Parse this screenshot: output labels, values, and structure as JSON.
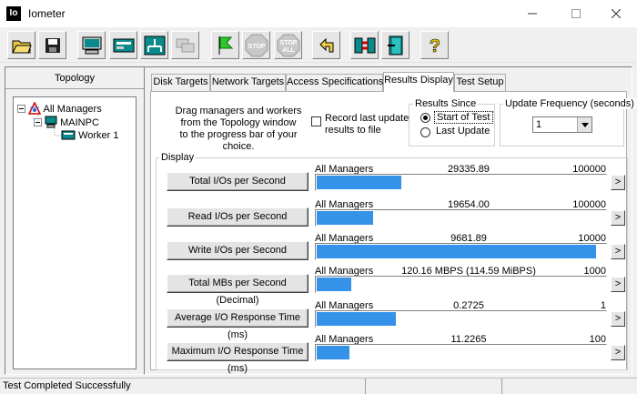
{
  "window": {
    "title": "Iometer",
    "icon_text": "Io"
  },
  "toolbar": {
    "buttons": [
      {
        "icon": "open-folder-icon"
      },
      {
        "icon": "save-disk-icon"
      },
      {
        "icon": "new-manager-icon"
      },
      {
        "icon": "new-disk-worker-icon"
      },
      {
        "icon": "new-network-worker-icon"
      },
      {
        "icon": "duplicate-worker-icon"
      },
      {
        "icon": "start-flag-icon"
      },
      {
        "icon": "stop-icon",
        "label": "STOP"
      },
      {
        "icon": "stop-all-icon",
        "label_top": "STOP",
        "label_bottom": "ALL"
      },
      {
        "icon": "reset-workers-icon"
      },
      {
        "icon": "disconnect-icon"
      },
      {
        "icon": "exit-door-icon"
      },
      {
        "icon": "help-icon",
        "label": "?"
      }
    ]
  },
  "topology": {
    "header": "Topology",
    "tree": [
      {
        "label": "All Managers",
        "icon": "managers-icon"
      },
      {
        "label": "MAINPC",
        "icon": "computer-icon"
      },
      {
        "label": "Worker 1",
        "icon": "disk-worker-icon"
      }
    ]
  },
  "tabs": [
    {
      "label": "Disk Targets",
      "active": false
    },
    {
      "label": "Network Targets",
      "active": false
    },
    {
      "label": "Access Specifications",
      "active": false
    },
    {
      "label": "Results Display",
      "active": true
    },
    {
      "label": "Test Setup",
      "active": false
    }
  ],
  "results": {
    "instructions": [
      "Drag managers and workers",
      "from the Topology window",
      "to the progress bar of your choice."
    ],
    "record_label": [
      "Record last update",
      "results to file"
    ],
    "record_checked": false,
    "results_since": {
      "title": "Results Since",
      "options": [
        {
          "label": "Start of Test",
          "selected": true
        },
        {
          "label": "Last Update",
          "selected": false
        }
      ]
    },
    "update_frequency": {
      "title": "Update Frequency (seconds)",
      "value": "1"
    },
    "display_title": "Display",
    "rows": [
      {
        "button": "Total I/Os per Second",
        "source": "All Managers",
        "value": "29335.89",
        "max": "100000",
        "fill_fraction": 0.293
      },
      {
        "button": "Read I/Os per Second",
        "source": "All Managers",
        "value": "19654.00",
        "max": "100000",
        "fill_fraction": 0.197
      },
      {
        "button": "Write I/Os per Second",
        "source": "All Managers",
        "value": "9681.89",
        "max": "10000",
        "fill_fraction": 0.968
      },
      {
        "button": "Total MBs per Second (Decimal)",
        "source": "All Managers",
        "value": "120.16 MBPS (114.59 MiBPS)",
        "max": "1000",
        "fill_fraction": 0.12
      },
      {
        "button": "Average I/O Response Time (ms)",
        "source": "All Managers",
        "value": "0.2725",
        "max": "1",
        "fill_fraction": 0.273
      },
      {
        "button": "Maximum I/O Response Time (ms)",
        "source": "All Managers",
        "value": "11.2265",
        "max": "100",
        "fill_fraction": 0.112
      }
    ],
    "arrow_label": ">"
  },
  "status": {
    "text": "Test Completed Successfully"
  },
  "colors": {
    "bar": "#3592e9",
    "tab_border": "#adadad"
  }
}
